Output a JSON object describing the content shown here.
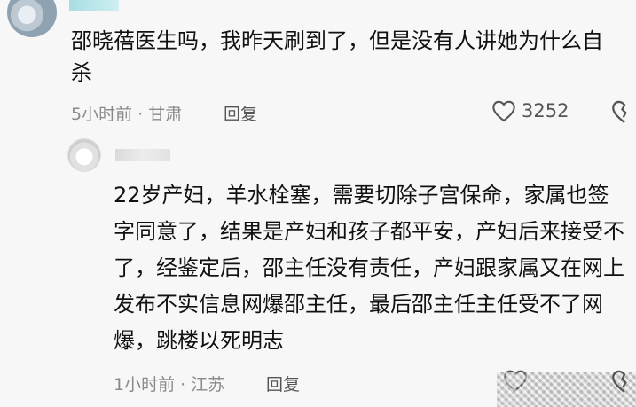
{
  "comment": {
    "text": "邵晓蓓医生吗，我昨天刷到了，但是没有人讲她为什么自杀",
    "meta": "5小时前 · 甘肃",
    "reply_label": "回复",
    "like_count": "3252"
  },
  "reply": {
    "text": "22岁产妇，羊水栓塞，需要切除子宫保命，家属也签字同意了，结果是产妇和孩子都平安，产妇后来接受不了，经鉴定后，邵主任没有责任，产妇跟家属又在网上发布不实信息网爆邵主任，最后邵主任主任受不了网爆，跳楼以死明志",
    "meta": "1小时前 · 江苏",
    "reply_label": "回复"
  },
  "icons": {
    "like": "heart-outline-icon",
    "dislike": "broken-heart-icon"
  }
}
